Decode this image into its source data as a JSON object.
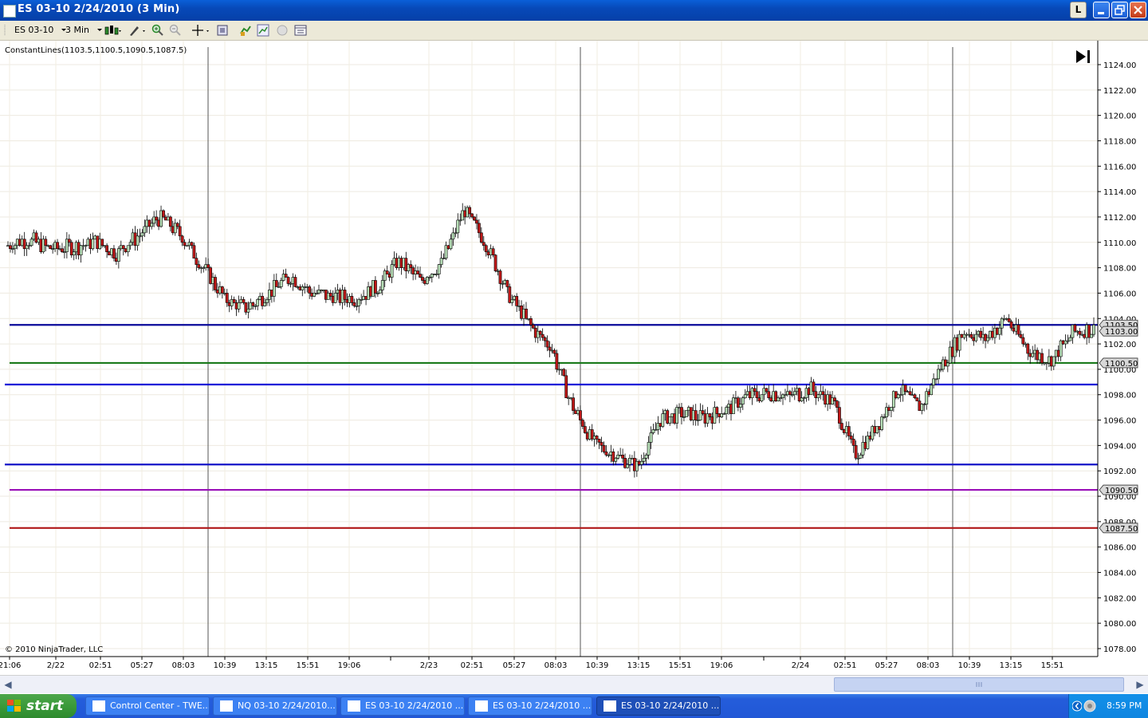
{
  "window": {
    "title": "ES 03-10  2/24/2010  (3 Min)",
    "l_button": "L"
  },
  "toolbar": {
    "instrument": "ES 03-10",
    "interval": "3 Min"
  },
  "chart": {
    "indicator_label": "ConstantLines(1103.5,1100.5,1090.5,1087.5)",
    "copyright": "© 2010 NinjaTrader, LLC",
    "y_ticks": [
      "1124.00",
      "1122.00",
      "1120.00",
      "1118.00",
      "1116.00",
      "1114.00",
      "1112.00",
      "1110.00",
      "1108.00",
      "1106.00",
      "1104.00",
      "1102.00",
      "1100.00",
      "1098.00",
      "1096.00",
      "1094.00",
      "1092.00",
      "1090.00",
      "1088.00",
      "1086.00",
      "1084.00",
      "1082.00",
      "1080.00",
      "1078.00"
    ],
    "x_ticks": [
      "21:06",
      "2/22",
      "02:51",
      "05:27",
      "08:03",
      "10:39",
      "13:15",
      "15:51",
      "19:06",
      "2/23",
      "02:51",
      "05:27",
      "08:03",
      "10:39",
      "13:15",
      "15:51",
      "19:06",
      "2/24",
      "02:51",
      "05:27",
      "08:03",
      "10:39",
      "13:15",
      "15:51"
    ],
    "price_tags": [
      {
        "label": "1103.50",
        "price": 1103.5,
        "color": "#d8d8d8"
      },
      {
        "label": "1103.00",
        "price": 1103.0,
        "color": "#d8d8d8"
      },
      {
        "label": "1100.50",
        "price": 1100.5,
        "color": "#d8d8d8"
      },
      {
        "label": "1090.50",
        "price": 1090.5,
        "color": "#d8d8d8"
      },
      {
        "label": "1087.50",
        "price": 1087.5,
        "color": "#d8d8d8"
      }
    ],
    "constant_lines": [
      {
        "price": 1103.5,
        "color": "#0a0a9a"
      },
      {
        "price": 1100.5,
        "color": "#1a7a1a"
      },
      {
        "price": 1098.8,
        "color": "#1010d8"
      },
      {
        "price": 1092.5,
        "color": "#1414c8"
      },
      {
        "price": 1090.5,
        "color": "#9a10b8"
      },
      {
        "price": 1087.5,
        "color": "#b01818"
      }
    ]
  },
  "chart_data": {
    "type": "candlestick",
    "title": "ES 03-10  2/24/2010  (3 Min)",
    "ylim": [
      1077,
      1125
    ],
    "grid": true,
    "categories": [
      "21:06",
      "2/22",
      "02:51",
      "05:27",
      "08:03",
      "10:39",
      "13:15",
      "15:51",
      "19:06",
      "2/23",
      "02:51",
      "05:27",
      "08:03",
      "10:39",
      "13:15",
      "15:51",
      "19:06",
      "2/24",
      "02:51",
      "05:27",
      "08:03",
      "10:39",
      "13:15",
      "15:51"
    ],
    "series": [
      {
        "name": "ES 03-10",
        "values": [
          1109.8,
          1110.2,
          1109.5,
          1109.6,
          1110.0,
          1109.2,
          1110.5,
          1112.0,
          1110.5,
          1108.0,
          1105.5,
          1104.8,
          1106.0,
          1107.3,
          1106.0,
          1105.7,
          1105.6,
          1106.5,
          1108.5,
          1107.0,
          1108.5,
          1112.5,
          1110.0,
          1106.0,
          1103.5,
          1101.8,
          1097.0,
          1094.2,
          1093.2,
          1092.3,
          1096.0,
          1096.5,
          1096.2,
          1096.8,
          1097.8,
          1098.2,
          1097.9,
          1098.4,
          1097.5,
          1093.2,
          1095.5,
          1098.4,
          1097.0,
          1100.3,
          1103.0,
          1102.4,
          1104.0,
          1101.5,
          1100.6,
          1102.8,
          1103.2
        ]
      }
    ],
    "constant_lines": [
      1103.5,
      1100.5,
      1090.5,
      1087.5
    ]
  },
  "taskbar": {
    "start_label": "start",
    "items": [
      "Control Center - TWE...",
      "NQ 03-10  2/24/2010...",
      "ES 03-10  2/24/2010 ...",
      "ES 03-10  2/24/2010 ...",
      "ES 03-10  2/24/2010 ..."
    ],
    "clock": "8:59 PM"
  }
}
